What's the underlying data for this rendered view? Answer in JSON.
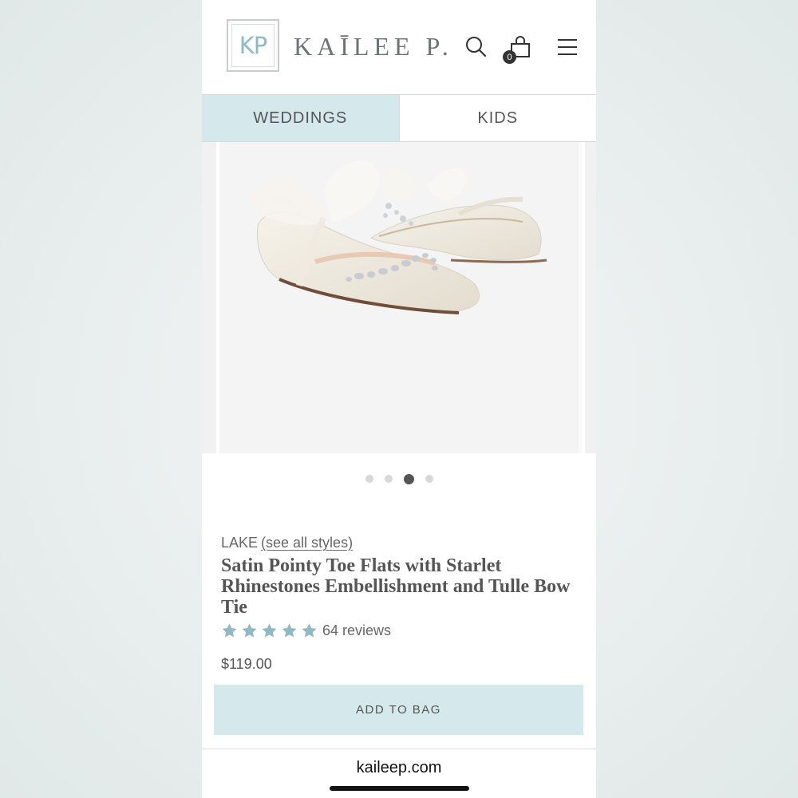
{
  "header": {
    "logo_text": "KP",
    "brand_name": "KAĪLEE P.",
    "bag_count": "0"
  },
  "tabs": [
    {
      "label": "WEDDINGS",
      "active": true
    },
    {
      "label": "KIDS",
      "active": false
    }
  ],
  "carousel": {
    "slide_count": 4,
    "active_index": 2
  },
  "product": {
    "collection": "LAKE",
    "see_all_link": "(see all styles)",
    "title": "Satin Pointy Toe Flats with Starlet Rhinestones Embellishment and Tulle Bow Tie",
    "rating": 5,
    "reviews": "64 reviews",
    "price": "$119.00",
    "add_button": "ADD TO BAG"
  },
  "browser": {
    "url": "kaileep.com"
  },
  "colors": {
    "accent": "#d5e9ec",
    "star": "#8fb9c4",
    "text": "#555555"
  }
}
